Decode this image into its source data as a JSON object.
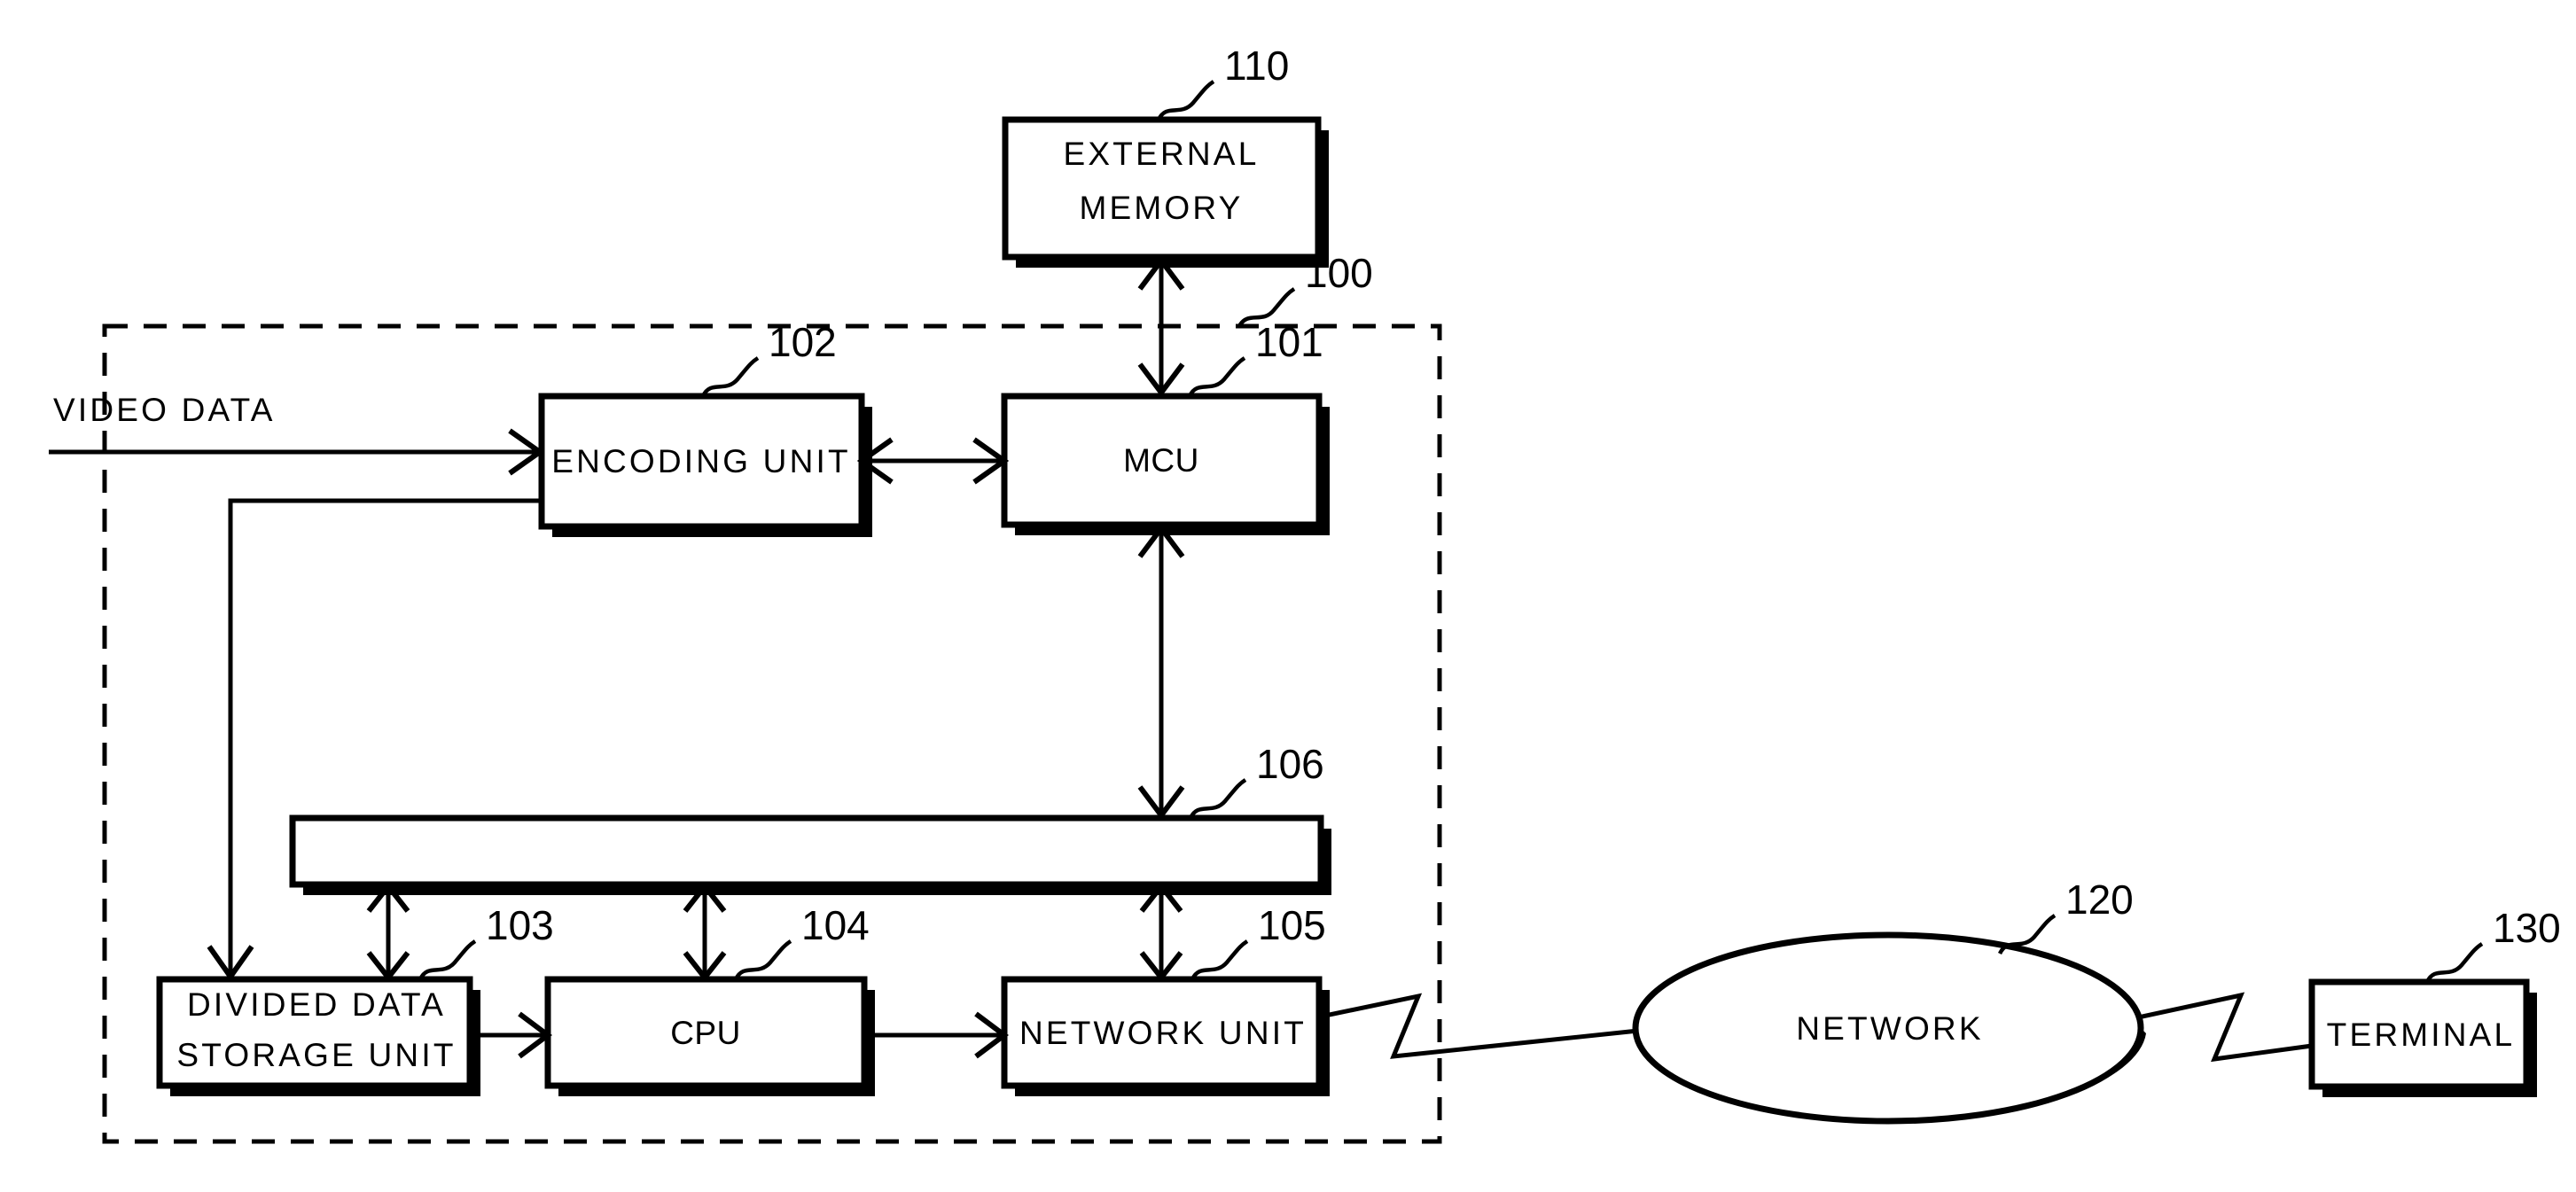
{
  "figure": {
    "kind": "patent-block-diagram",
    "background_color": "#ffffff",
    "line_color": "#000000"
  },
  "io": {
    "video_data_label": "VIDEO DATA"
  },
  "system_boundary": {
    "ref": "100",
    "style": "dashed"
  },
  "blocks": {
    "external_memory": {
      "label_line1": "EXTERNAL",
      "label_line2": "MEMORY",
      "ref": "110"
    },
    "encoding_unit": {
      "label": "ENCODING UNIT",
      "ref": "102"
    },
    "mcu": {
      "label": "MCU",
      "ref": "101"
    },
    "bus": {
      "label": "",
      "ref": "106"
    },
    "divided_storage": {
      "label_line1": "DIVIDED DATA",
      "label_line2": "STORAGE UNIT",
      "ref": "103"
    },
    "cpu": {
      "label": "CPU",
      "ref": "104"
    },
    "network_unit": {
      "label": "NETWORK UNIT",
      "ref": "105"
    },
    "network": {
      "label": "NETWORK",
      "ref": "120"
    },
    "terminal": {
      "label": "TERMINAL",
      "ref": "130"
    }
  }
}
